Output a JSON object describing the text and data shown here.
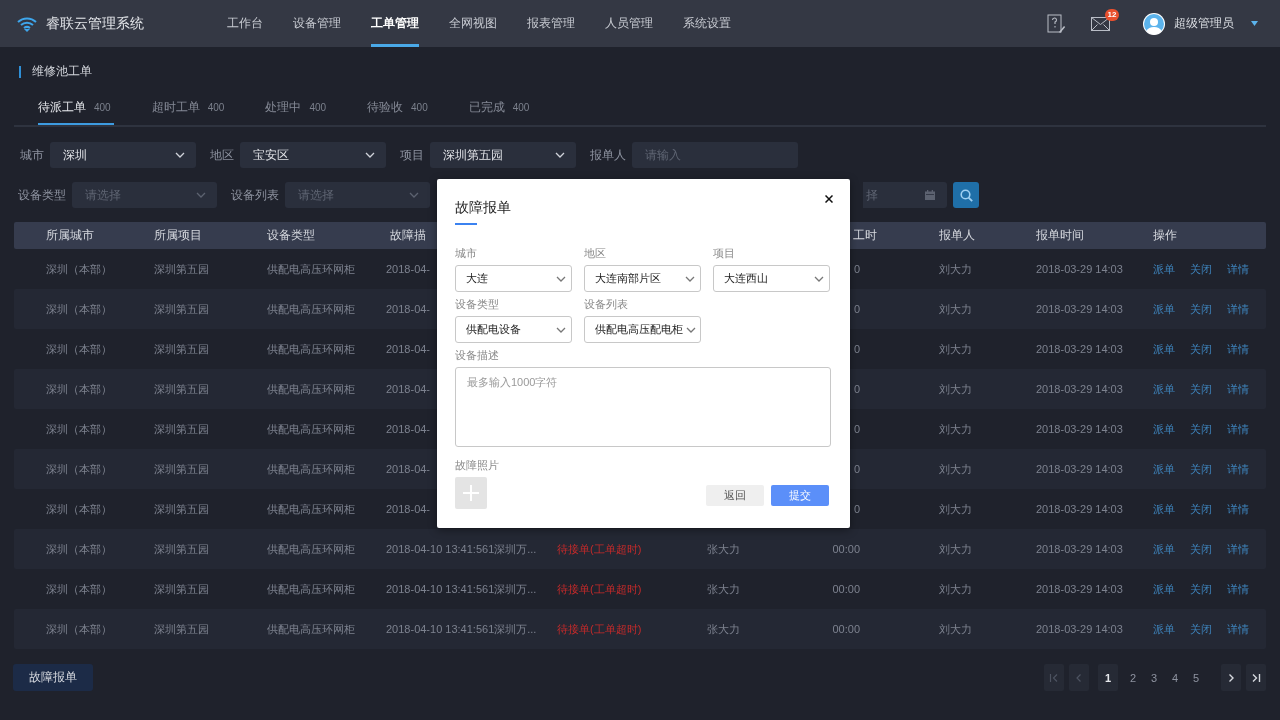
{
  "header": {
    "app_title": "睿联云管理系统",
    "nav": [
      {
        "label": "工作台",
        "selected": false
      },
      {
        "label": "设备管理",
        "selected": false
      },
      {
        "label": "工单管理",
        "selected": true
      },
      {
        "label": "全网视图",
        "selected": false
      },
      {
        "label": "报表管理",
        "selected": false
      },
      {
        "label": "人员管理",
        "selected": false
      },
      {
        "label": "系统设置",
        "selected": false
      }
    ],
    "mail_badge": "12",
    "user_name": "超级管理员"
  },
  "section_title": "维修池工单",
  "tabs": [
    {
      "label": "待派工单",
      "count": "400",
      "selected": true
    },
    {
      "label": "超时工单",
      "count": "400",
      "selected": false
    },
    {
      "label": "处理中",
      "count": "400",
      "selected": false
    },
    {
      "label": "待验收",
      "count": "400",
      "selected": false
    },
    {
      "label": "已完成",
      "count": "400",
      "selected": false
    }
  ],
  "filters": [
    [
      {
        "kind": "select",
        "label": "城市",
        "value": "深圳"
      },
      {
        "kind": "select",
        "label": "地区",
        "value": "宝安区"
      },
      {
        "kind": "select",
        "label": "项目",
        "value": "深圳第五园"
      },
      {
        "kind": "input",
        "label": "报单人",
        "placeholder": "请输入"
      }
    ],
    [
      {
        "kind": "select",
        "label": "设备类型",
        "placeholder": "请选择"
      },
      {
        "kind": "select",
        "label": "设备列表",
        "placeholder": "请选择"
      },
      {
        "kind": "date",
        "placeholder": "择"
      },
      {
        "kind": "search"
      }
    ]
  ],
  "table": {
    "columns": {
      "city": "所属城市",
      "project": "所属项目",
      "device_type": "设备类型",
      "description": "故障描",
      "column_7": "工时",
      "reporter": "报单人",
      "report_time": "报单时间",
      "actions": "操作"
    },
    "rows": [
      {
        "city": "深圳（本部）",
        "project": "深圳第五园",
        "device_type": "供配电高压环网柜",
        "description": "2018-04-",
        "column_7": "0",
        "reporter": "刘大力",
        "report_time": "2018-03-29 14:03",
        "actions": [
          "派单",
          "关闭",
          "详情"
        ]
      },
      {
        "city": "深圳（本部）",
        "project": "深圳第五园",
        "device_type": "供配电高压环网柜",
        "description": "2018-04-",
        "column_7": "0",
        "reporter": "刘大力",
        "report_time": "2018-03-29 14:03",
        "actions": [
          "派单",
          "关闭",
          "详情"
        ]
      },
      {
        "city": "深圳（本部）",
        "project": "深圳第五园",
        "device_type": "供配电高压环网柜",
        "description": "2018-04-",
        "column_7": "0",
        "reporter": "刘大力",
        "report_time": "2018-03-29 14:03",
        "actions": [
          "派单",
          "关闭",
          "详情"
        ]
      },
      {
        "city": "深圳（本部）",
        "project": "深圳第五园",
        "device_type": "供配电高压环网柜",
        "description": "2018-04-",
        "column_7": "0",
        "reporter": "刘大力",
        "report_time": "2018-03-29 14:03",
        "actions": [
          "派单",
          "关闭",
          "详情"
        ]
      },
      {
        "city": "深圳（本部）",
        "project": "深圳第五园",
        "device_type": "供配电高压环网柜",
        "description": "2018-04-",
        "column_7": "0",
        "reporter": "刘大力",
        "report_time": "2018-03-29 14:03",
        "actions": [
          "派单",
          "关闭",
          "详情"
        ]
      },
      {
        "city": "深圳（本部）",
        "project": "深圳第五园",
        "device_type": "供配电高压环网柜",
        "description": "2018-04-",
        "column_7": "0",
        "reporter": "刘大力",
        "report_time": "2018-03-29 14:03",
        "actions": [
          "派单",
          "关闭",
          "详情"
        ]
      },
      {
        "city": "深圳（本部）",
        "project": "深圳第五园",
        "device_type": "供配电高压环网柜",
        "description": "2018-04-",
        "column_7": "0",
        "reporter": "刘大力",
        "report_time": "2018-03-29 14:03",
        "actions": [
          "派单",
          "关闭",
          "详情"
        ]
      },
      {
        "city": "深圳（本部）",
        "project": "深圳第五园",
        "device_type": "供配电高压环网柜",
        "description": "2018-04-10 13:41:561深圳万...",
        "status": "待接单(工单超时)",
        "handler": "张大力",
        "column_7": "00:00",
        "reporter": "刘大力",
        "report_time": "2018-03-29 14:03",
        "actions": [
          "派单",
          "关闭",
          "详情"
        ]
      },
      {
        "city": "深圳（本部）",
        "project": "深圳第五园",
        "device_type": "供配电高压环网柜",
        "description": "2018-04-10 13:41:561深圳万...",
        "status": "待接单(工单超时)",
        "handler": "张大力",
        "column_7": "00:00",
        "reporter": "刘大力",
        "report_time": "2018-03-29 14:03",
        "actions": [
          "派单",
          "关闭",
          "详情"
        ]
      },
      {
        "city": "深圳（本部）",
        "project": "深圳第五园",
        "device_type": "供配电高压环网柜",
        "description": "2018-04-10 13:41:561深圳万...",
        "status": "待接单(工单超时)",
        "handler": "张大力",
        "column_7": "00:00",
        "reporter": "刘大力",
        "report_time": "2018-03-29 14:03",
        "actions": [
          "派单",
          "关闭",
          "详情"
        ]
      }
    ]
  },
  "report_button": "故障报单",
  "pagination": {
    "nav_before": [
      {
        "kind": "first",
        "disabled": true
      },
      {
        "kind": "prev",
        "disabled": true
      }
    ],
    "pages": [
      {
        "label": "1",
        "selected": true
      },
      {
        "label": "2",
        "selected": false
      },
      {
        "label": "3",
        "selected": false
      },
      {
        "label": "4",
        "selected": false
      },
      {
        "label": "5",
        "selected": false
      }
    ],
    "nav_after": [
      {
        "kind": "next",
        "disabled": false
      },
      {
        "kind": "last",
        "disabled": false
      }
    ]
  },
  "modal": {
    "title": "故障报单",
    "fields": [
      {
        "label": "城市",
        "value": "大连"
      },
      {
        "label": "地区",
        "value": "大连南部片区"
      },
      {
        "label": "项目",
        "value": "大连西山"
      },
      {
        "label": "设备类型",
        "value": "供配电设备"
      },
      {
        "label": "设备列表",
        "value": "供配电高压配电柜"
      }
    ],
    "description": {
      "label": "设备描述",
      "placeholder": "最多输入1000字符"
    },
    "photo": {
      "label": "故障照片"
    },
    "buttons": [
      {
        "label": "返回",
        "kind": "secondary"
      },
      {
        "label": "提交",
        "kind": "primary"
      }
    ]
  }
}
